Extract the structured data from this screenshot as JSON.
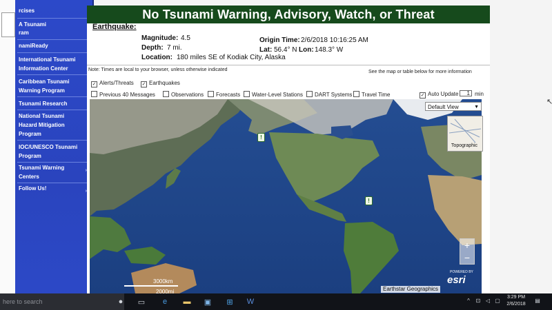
{
  "sidebar": {
    "items": [
      {
        "label": "rcises"
      },
      {
        "label": "A Tsunami"
      },
      {
        "label": "ram"
      },
      {
        "label": "namiReady"
      },
      {
        "label": "International Tsunami"
      },
      {
        "label": "Information Center"
      },
      {
        "label": "Caribbean Tsunami"
      },
      {
        "label": "Warning Program"
      },
      {
        "label": "Tsunami Research"
      },
      {
        "label": "National Tsunami"
      },
      {
        "label": "Hazard Mitigation"
      },
      {
        "label": "Program"
      },
      {
        "label": "IOC/UNESCO Tsunami"
      },
      {
        "label": "Program"
      },
      {
        "label": "Tsunami Warning"
      },
      {
        "label": "Centers"
      },
      {
        "label": "Follow Us!"
      }
    ],
    "chevron": "›"
  },
  "banner": {
    "title": "No Tsunami Warning, Advisory, Watch, or Threat"
  },
  "earthquake": {
    "heading": "Earthquake:",
    "magnitude_label": "Magnitude:",
    "magnitude": "4.5",
    "depth_label": "Depth:",
    "depth": "7 mi.",
    "location_label": "Location:",
    "location": "180 miles SE of Kodiak City, Alaska",
    "origin_label": "Origin Time:",
    "origin": "2/6/2018 10:16:25 AM",
    "lat_label": "Lat:",
    "lat": "56.4° N",
    "lon_label": "Lon:",
    "lon": "148.3° W"
  },
  "notes": {
    "local_time": "Note: Times are local to your browser, unless otherwise indicated",
    "see_map": "See the map or table below for more information"
  },
  "layers": {
    "alerts": {
      "label": "Alerts/Threats",
      "checked": true
    },
    "earthquakes": {
      "label": "Earthquakes",
      "checked": true
    },
    "previous": {
      "label": "Previous 40 Messages",
      "checked": false
    },
    "observations": {
      "label": "Observations",
      "checked": false
    },
    "forecasts": {
      "label": "Forecasts",
      "checked": false
    },
    "water_level": {
      "label": "Water-Level Stations",
      "checked": false
    },
    "dart": {
      "label": "DART Systems",
      "checked": false
    },
    "travel_time": {
      "label": "Travel Time",
      "checked": false
    },
    "auto_update": {
      "label": "Auto Update",
      "checked": true,
      "value": "1",
      "unit": "min"
    }
  },
  "map": {
    "view_select": "Default View",
    "basemap_label": "Topographic",
    "zoom_in": "+",
    "zoom_out": "−",
    "powered_by": "POWERED BY",
    "esri": "esri",
    "attribution": "Earthstar Geographics",
    "scale_km": "3000km",
    "scale_mi": "2000mi"
  },
  "taskbar": {
    "search_placeholder": "here to search",
    "time": "3:29 PM",
    "date": "2/6/2018"
  },
  "colors": {
    "banner_green": "#164a1c",
    "sidebar_blue": "#2c49c9",
    "ocean": "#183c7a"
  }
}
